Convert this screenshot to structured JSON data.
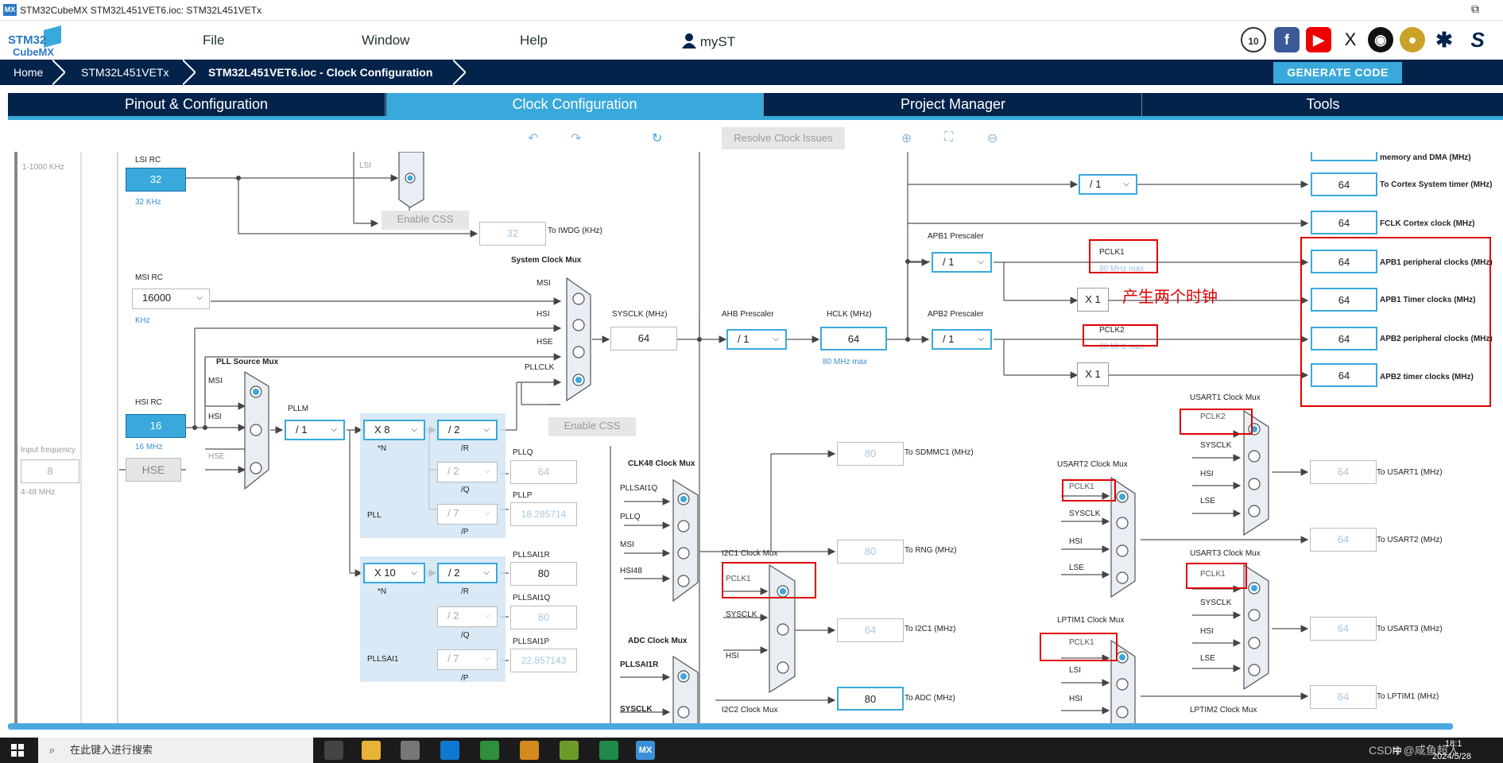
{
  "window": {
    "app_icon": "MX",
    "title": "STM32CubeMX STM32L451VET6.ioc: STM32L451VETx",
    "restore_icon": "⧉"
  },
  "logo": {
    "line1": "STM32",
    "line2": "CubeMX"
  },
  "menu": {
    "file": "File",
    "window": "Window",
    "help": "Help",
    "myst": "myST"
  },
  "breadcrumb": {
    "home": "Home",
    "device": "STM32L451VETx",
    "page": "STM32L451VET6.ioc - Clock Configuration"
  },
  "generate_code": "GENERATE CODE",
  "tabs": [
    "Pinout & Configuration",
    "Clock Configuration",
    "Project Manager",
    "Tools"
  ],
  "toolbar": {
    "resolve": "Resolve Clock Issues"
  },
  "clock": {
    "left_range": "1-1000 KHz",
    "input_frequency": "Input frequency",
    "hse_input": "8",
    "hse_range": "4-48 MHz",
    "lsi_rc": "LSI RC",
    "lsi_value": "32",
    "lsi_unit": "32 KHz",
    "lsi_mux_label": "LSI",
    "enable_css": "Enable CSS",
    "iwdg_value": "32",
    "iwdg_label": "To IWDG (KHz)",
    "msi_rc": "MSI RC",
    "msi_value": "16000",
    "msi_unit": "KHz",
    "hsi_rc": "HSI RC",
    "hsi_value": "16",
    "hsi_unit": "16 MHz",
    "hse": "HSE",
    "pll_source_mux": "PLL Source Mux",
    "pll_mux_msi": "MSI",
    "pll_mux_hsi": "HSI",
    "pll_mux_hse": "HSE",
    "pllm_label": "PLLM",
    "pllm": "/ 1",
    "system_clock_mux": "System Clock Mux",
    "sys_msi": "MSI",
    "sys_hsi": "HSI",
    "sys_hse": "HSE",
    "sys_pllclk": "PLLCLK",
    "enable_css2": "Enable CSS",
    "sysclk_label": "SYSCLK (MHz)",
    "sysclk": "64",
    "ahb_label": "AHB Prescaler",
    "ahb": "/ 1",
    "hclk_label": "HCLK (MHz)",
    "hclk": "64",
    "hclk_max": "80 MHz max",
    "pll_n": "X 8",
    "pll_n_lbl": "*N",
    "pll_r": "/ 2",
    "pll_r_lbl": "/R",
    "pll_q": "/ 2",
    "pll_q_lbl": "/Q",
    "pll_p": "/ 7",
    "pll_p_lbl": "/P",
    "pll_lbl": "PLL",
    "pllq_label": "PLLQ",
    "pllq": "64",
    "pllp_label": "PLLP",
    "pllp": "18.285714",
    "sai_n": "X 10",
    "sai_n_lbl": "*N",
    "sai_r": "/ 2",
    "sai_r_lbl": "/R",
    "sai_q": "/ 2",
    "sai_q_lbl": "/Q",
    "sai_p": "/ 7",
    "sai_p_lbl": "/P",
    "sai_lbl": "PLLSAI1",
    "sai_r_out_label": "PLLSAI1R",
    "sai_r_out": "80",
    "sai_q_out_label": "PLLSAI1Q",
    "sai_q_out": "80",
    "sai_p_out_label": "PLLSAI1P",
    "sai_p_out": "22.857143",
    "clk48_mux": "CLK48 Clock Mux",
    "c48_in1": "PLLSAI1Q",
    "c48_in2": "PLLQ",
    "c48_in3": "MSI",
    "c48_in4": "HSI48",
    "sdmmc_value": "80",
    "sdmmc_label": "To SDMMC1 (MHz)",
    "rng_value": "80",
    "rng_label": "To RNG (MHz)",
    "i2c1_mux": "I2C1 Clock Mux",
    "i2c1_in1": "PCLK1",
    "i2c1_in2": "SYSCLK",
    "i2c1_in3": "HSI",
    "i2c1_value": "64",
    "i2c1_label": "To I2C1 (MHz)",
    "adc_mux": "ADC Clock Mux",
    "adc_in1": "PLLSAI1R",
    "adc_in2": "SYSCLK",
    "adc_value": "80",
    "adc_label": "To ADC (MHz)",
    "i2c2_mux": "I2C2 Clock Mux",
    "apb1_label": "APB1 Prescaler",
    "apb1": "/ 1",
    "pclk1": "PCLK1",
    "pclk1_max": "80 MHz max",
    "apb1_x1": "X 1",
    "apb2_label": "APB2 Prescaler",
    "apb2": "/ 1",
    "pclk2": "PCLK2",
    "pclk2_max": "80 MHz max",
    "apb2_x1": "X 1",
    "annotation": "产生两个时钟",
    "systick_div": "/ 1",
    "out_mem_label": "memory and DMA (MHz)",
    "out_cortex_timer": "64",
    "out_cortex_timer_label": "To Cortex System timer (MHz)",
    "out_fclk": "64",
    "out_fclk_label": "FCLK Cortex clock (MHz)",
    "out_apb1_periph": "64",
    "out_apb1_periph_label": "APB1 peripheral clocks (MHz)",
    "out_apb1_timer": "64",
    "out_apb1_timer_label": "APB1 Timer clocks (MHz)",
    "out_apb2_periph": "64",
    "out_apb2_periph_label": "APB2 peripheral clocks (MHz)",
    "out_apb2_timer": "64",
    "out_apb2_timer_label": "APB2 timer clocks (MHz)",
    "usart1_mux": "USART1 Clock Mux",
    "u1_in1": "PCLK2",
    "u1_in2": "SYSCLK",
    "u1_in3": "HSI",
    "u1_in4": "LSE",
    "u1_value": "64",
    "u1_label": "To USART1 (MHz)",
    "usart2_mux": "USART2 Clock Mux",
    "u2_in1": "PCLK1",
    "u2_in2": "SYSCLK",
    "u2_in3": "HSI",
    "u2_in4": "LSE",
    "u2_value": "64",
    "u2_label": "To USART2 (MHz)",
    "usart3_mux": "USART3 Clock Mux",
    "u3_in1": "PCLK1",
    "u3_in2": "SYSCLK",
    "u3_in3": "HSI",
    "u3_in4": "LSE",
    "u3_value": "64",
    "u3_label": "To USART3 (MHz)",
    "lptim1_mux": "LPTIM1 Clock Mux",
    "l1_in1": "PCLK1",
    "l1_in2": "LSI",
    "l1_in3": "HSI",
    "l1_value": "64",
    "l1_label": "To LPTIM1 (MHz)",
    "lptim2_mux": "LPTIM2 Clock Mux"
  },
  "taskbar": {
    "search": "在此键入进行搜索",
    "watermark": "CSDN @咸鱼超人",
    "time": "18:1",
    "date": "2024/5/28",
    "ime": "中"
  },
  "colors": {
    "navy": "#03234b",
    "accent": "#39a9dc",
    "highlight": "#e00000"
  }
}
